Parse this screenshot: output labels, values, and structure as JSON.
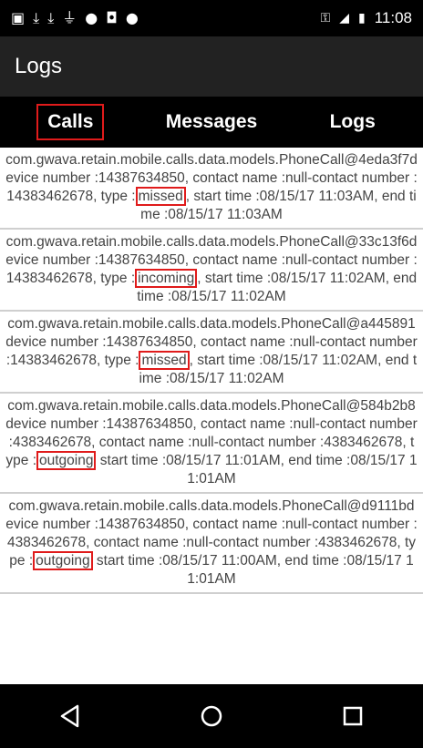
{
  "status_bar": {
    "icons_left": [
      "image-icon",
      "download-icon",
      "download-icon",
      "usb-icon",
      "android-icon",
      "save-icon",
      "android-icon"
    ],
    "icons_right": [
      "vpn-key-icon",
      "signal-icon",
      "battery-icon"
    ],
    "time": "11:08"
  },
  "app_bar": {
    "title": "Logs"
  },
  "tabs": [
    {
      "label": "Calls",
      "selected": true
    },
    {
      "label": "Messages",
      "selected": false
    },
    {
      "label": "Logs",
      "selected": false
    }
  ],
  "logs": [
    {
      "pre": "com.gwava.retain.mobile.calls.data.models.PhoneCall@4eda3f7device number :14387634850, contact name :null-contact number :14383462678, type :",
      "type": "missed",
      "post": ", start time :08/15/17 11:03AM, end time :08/15/17 11:03AM"
    },
    {
      "pre": "com.gwava.retain.mobile.calls.data.models.PhoneCall@33c13f6device number :14387634850, contact name :null-contact number :14383462678, type :",
      "type": "incoming",
      "post": ", start time :08/15/17 11:02AM, end time :08/15/17 11:02AM"
    },
    {
      "pre": "com.gwava.retain.mobile.calls.data.models.PhoneCall@a445891device number :14387634850, contact name :null-contact number :14383462678, type :",
      "type": "missed",
      "post": ", start time :08/15/17 11:02AM, end time :08/15/17 11:02AM"
    },
    {
      "pre": "com.gwava.retain.mobile.calls.data.models.PhoneCall@584b2b8device number :14387634850, contact name :null-contact number :4383462678, contact name :null-contact number :4383462678, type :",
      "type": "outgoing",
      "post": " start time :08/15/17 11:01AM, end time :08/15/17 11:01AM"
    },
    {
      "pre": "com.gwava.retain.mobile.calls.data.models.PhoneCall@d9111bdevice number :14387634850, contact name :null-contact number :4383462678, contact name :null-contact number :4383462678, type :",
      "type": "outgoing",
      "post": " start time :08/15/17 11:00AM, end time :08/15/17 11:01AM"
    }
  ],
  "nav_bar": {
    "icons": [
      "back-icon",
      "home-icon",
      "recents-icon"
    ]
  },
  "colors": {
    "highlight": "#e01b1b",
    "app_bar_bg": "#222222",
    "tab_bar_bg": "#000000"
  }
}
